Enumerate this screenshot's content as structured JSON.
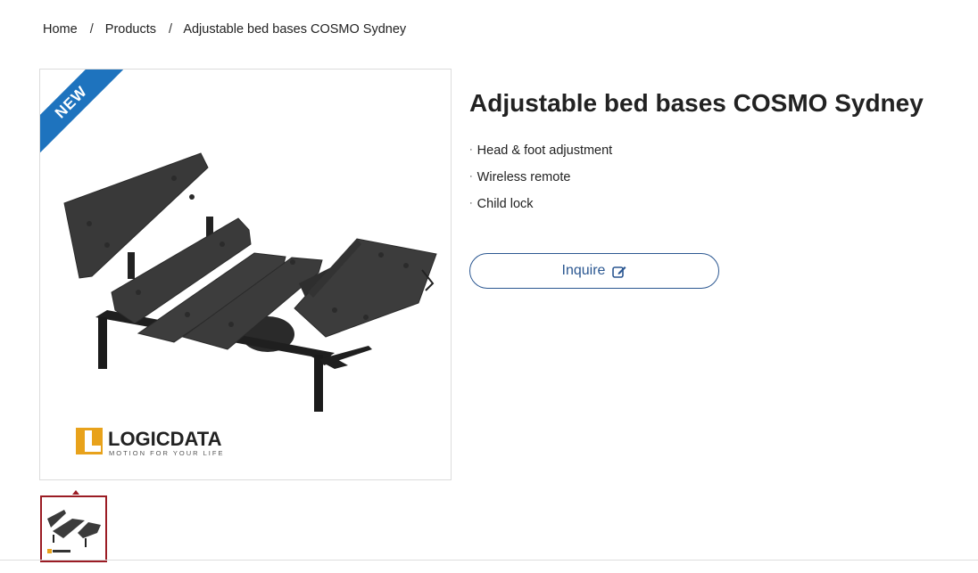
{
  "breadcrumb": {
    "home": "Home",
    "products": "Products",
    "current": "Adjustable bed bases COSMO Sydney",
    "separator": "/"
  },
  "product": {
    "title": "Adjustable bed bases COSMO Sydney",
    "badge": "NEW",
    "features": [
      "Head & foot adjustment",
      "Wireless remote",
      "Child lock"
    ],
    "bullet": "·",
    "inquire_label": "Inquire",
    "brand": {
      "name": "LOGICDATA",
      "tagline": "MOTION FOR YOUR LIFE"
    }
  },
  "colors": {
    "accent_blue": "#2b5791",
    "ribbon_blue": "#1e73be",
    "thumb_border": "#9b1c24",
    "logo_orange": "#e8a21b"
  },
  "icons": {
    "inquire": "edit-icon"
  }
}
